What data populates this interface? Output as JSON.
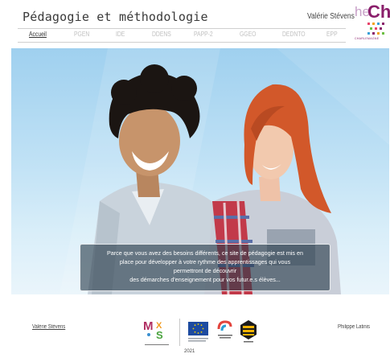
{
  "header": {
    "site_title": "Pédagogie et méthodologie",
    "author": "Valérie Stévens",
    "logo": {
      "he": "he",
      "ch": "Ch",
      "tagline": "CHARLEMAGNE"
    }
  },
  "nav": {
    "items": [
      {
        "label": "Accueil",
        "active": true
      },
      {
        "label": "PGEN",
        "active": false
      },
      {
        "label": "IDE",
        "active": false
      },
      {
        "label": "DDENS",
        "active": false
      },
      {
        "label": "PAPP-2",
        "active": false
      },
      {
        "label": "GGEO",
        "active": false
      },
      {
        "label": "DEDNTO",
        "active": false
      },
      {
        "label": "EPP",
        "active": false
      }
    ]
  },
  "hero": {
    "caption_lines": [
      "Parce que vous avez des besoins différents, ce site de pédagogie est mis en",
      "place pour développer à votre rythme des apprentissages qui vous",
      "permettront de découvrir",
      "des démarches d'enseignement pour vos futur.e.s élèves..."
    ]
  },
  "footer": {
    "left_author": "Valérie Stévens",
    "right_author": "Philippe Latinis",
    "year": "2021"
  },
  "colors": {
    "brand": "#8a1f6b",
    "sky": "#a9d6f1",
    "caption_bg": "#2f4656"
  }
}
